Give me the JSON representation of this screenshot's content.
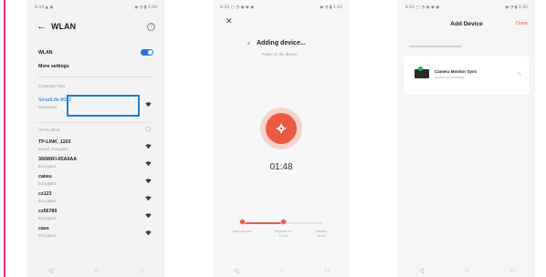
{
  "screen1": {
    "status_left": "8:24 ▲ ◉",
    "status_right": "◉ ◔ ▮ 1:44",
    "title": "WLAN",
    "help_icon": "?",
    "wlan_label": "WLAN",
    "more_settings": "More settings",
    "connected_label": "CONNECTED",
    "connected_network": {
      "name": "SmartLife-8052",
      "status": "Connected"
    },
    "available_label": "AVAILABLE",
    "networks": [
      {
        "name": "TP-LINK_1103",
        "status": "Saved, encrypted"
      },
      {
        "name": "360WiFi-65A6AA",
        "status": "Encrypted"
      },
      {
        "name": "caiwu",
        "status": "Encrypted"
      },
      {
        "name": "cz123",
        "status": "Encrypted"
      },
      {
        "name": "cz56789",
        "status": "Encrypted"
      },
      {
        "name": "cass",
        "status": "Encrypted"
      }
    ]
  },
  "screen2": {
    "status_left": "8:24 ▢ ◔ ◉ ◉ ◉",
    "status_right": "◉ ◔ ▮ 1:43",
    "close": "✕",
    "title": "Adding device...",
    "subtitle": "Power on the device.",
    "timer": "01:48",
    "steps": [
      "Scan devices",
      "Register on Cloud",
      "Initialize device"
    ],
    "progress_fraction": 0.55
  },
  "screen3": {
    "status_left": "8:24 ▢ ◔ ◉ ◉ ◉",
    "status_right": "◉ ◔ ▮ 1:45",
    "title": "Add Device",
    "done": "Done",
    "device_name": "Camera Monitor Sync",
    "device_status": "Added successfully"
  },
  "nav": {
    "back": "◁",
    "home": "○",
    "recent": "□"
  },
  "colors": {
    "accent": "#ec5a43",
    "wlan_blue": "#2a6fe0",
    "highlight_blue": "#1b7fd1",
    "frame_pink": "#d9368b"
  }
}
